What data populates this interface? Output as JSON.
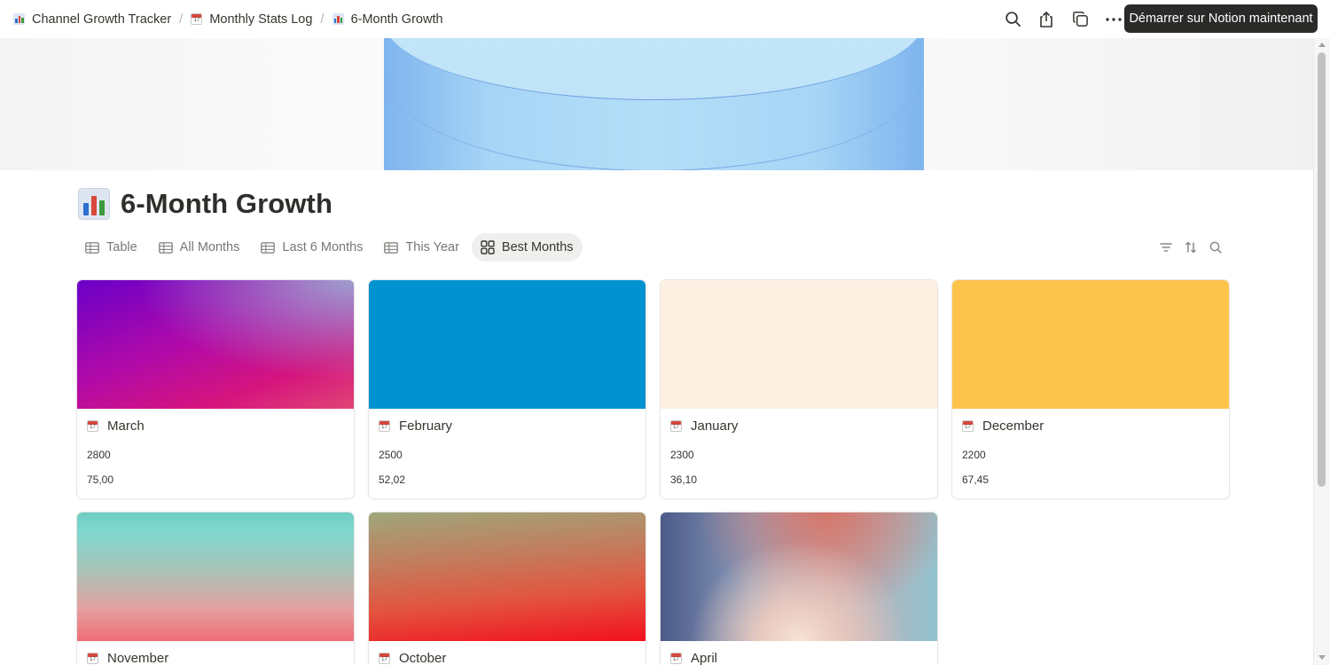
{
  "breadcrumb": [
    {
      "label": "Channel Growth Tracker",
      "icon": "bar-chart-icon"
    },
    {
      "label": "Monthly Stats Log",
      "icon": "calendar-icon"
    },
    {
      "label": "6-Month Growth",
      "icon": "bar-chart-icon"
    }
  ],
  "topbar": {
    "icons": [
      "search-icon",
      "share-icon",
      "duplicate-icon",
      "more-icon"
    ],
    "cta_label": "Démarrer sur Notion maintenant"
  },
  "page": {
    "title": "6-Month Growth",
    "icon": "bar-chart-icon"
  },
  "views": {
    "tabs": [
      {
        "label": "Table",
        "icon": "table-icon",
        "active": false
      },
      {
        "label": "All Months",
        "icon": "table-icon",
        "active": false
      },
      {
        "label": "Last 6 Months",
        "icon": "table-icon",
        "active": false
      },
      {
        "label": "This Year",
        "icon": "table-icon",
        "active": false
      },
      {
        "label": "Best Months",
        "icon": "gallery-icon",
        "active": true
      }
    ],
    "tools": [
      "filter-icon",
      "sort-icon",
      "search-icon"
    ]
  },
  "gallery": {
    "cards": [
      {
        "name": "March",
        "value1": "2800",
        "value2": "75,00"
      },
      {
        "name": "February",
        "value1": "2500",
        "value2": "52,02",
        "cover_color": "#0193d0"
      },
      {
        "name": "January",
        "value1": "2300",
        "value2": "36,10",
        "cover_color": "#fdefe2"
      },
      {
        "name": "December",
        "value1": "2200",
        "value2": "67,45",
        "cover_color": "#fdc44c"
      },
      {
        "name": "November"
      },
      {
        "name": "October"
      },
      {
        "name": "April"
      }
    ]
  },
  "colors": {
    "cta_bg": "#2a2a28",
    "active_tab_bg": "#efefee",
    "text": "#37352f"
  }
}
